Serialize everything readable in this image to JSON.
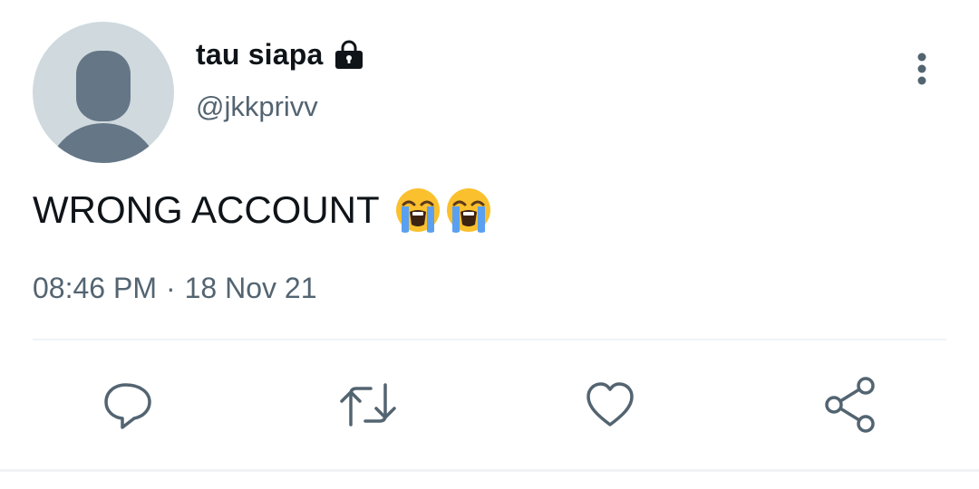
{
  "tweet": {
    "author": {
      "display_name": "tau siapa",
      "handle": "@jkkprivv",
      "protected_icon": "lock-icon",
      "avatar": "default-avatar"
    },
    "text": "WRONG ACCOUNT",
    "emojis": [
      "loudly-crying-face",
      "loudly-crying-face"
    ],
    "time": "08:46 PM",
    "separator": "·",
    "date": "18 Nov 21"
  },
  "actions": [
    {
      "name": "reply",
      "icon": "reply-icon"
    },
    {
      "name": "retweet",
      "icon": "retweet-icon"
    },
    {
      "name": "like",
      "icon": "heart-icon"
    },
    {
      "name": "share",
      "icon": "share-icon"
    }
  ],
  "colors": {
    "text_primary": "#0f1419",
    "text_secondary": "#536471",
    "avatar_bg": "#cfd9de",
    "avatar_fg": "#657786",
    "divider": "#eff3f4"
  }
}
